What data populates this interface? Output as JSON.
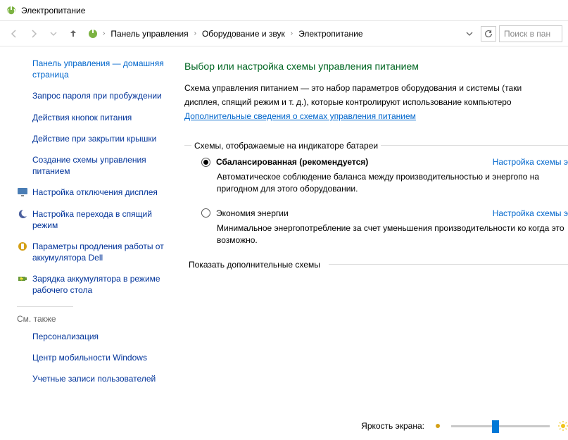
{
  "window": {
    "title": "Электропитание"
  },
  "breadcrumb": {
    "items": [
      "Панель управления",
      "Оборудование и звук",
      "Электропитание"
    ]
  },
  "search": {
    "placeholder": "Поиск в пан"
  },
  "sidebar": {
    "home": "Панель управления — домашняя страница",
    "links": [
      "Запрос пароля при пробуждении",
      "Действия кнопок питания",
      "Действие при закрытии крышки",
      "Создание схемы управления питанием",
      "Настройка отключения дисплея",
      "Настройка перехода в спящий режим",
      "Параметры продления работы от аккумулятора Dell",
      "Зарядка аккумулятора в режиме рабочего стола"
    ],
    "seeAlsoHeader": "См. также",
    "seeAlso": [
      "Персонализация",
      "Центр мобильности Windows",
      "Учетные записи пользователей"
    ]
  },
  "main": {
    "heading": "Выбор или настройка схемы управления питанием",
    "intro1": "Схема управления питанием — это набор параметров оборудования и системы (таки",
    "intro2": "дисплея, спящий режим и т. д.), которые контролируют использование компьютеро",
    "introLink": "Дополнительные сведения о схемах управления питанием",
    "groupLegend": "Схемы, отображаемые на индикаторе батареи",
    "plans": [
      {
        "name": "Сбалансированная (рекомендуется)",
        "selected": true,
        "link": "Настройка схемы э",
        "desc": "Автоматическое соблюдение баланса между производительностью и энергопо на пригодном для этого оборудовании."
      },
      {
        "name": "Экономия энергии",
        "selected": false,
        "link": "Настройка схемы э",
        "desc": "Минимальное энергопотребление за счет уменьшения производительности ко когда это возможно."
      }
    ],
    "expandLabel": "Показать дополнительные схемы",
    "brightnessLabel": "Яркость экрана:"
  }
}
